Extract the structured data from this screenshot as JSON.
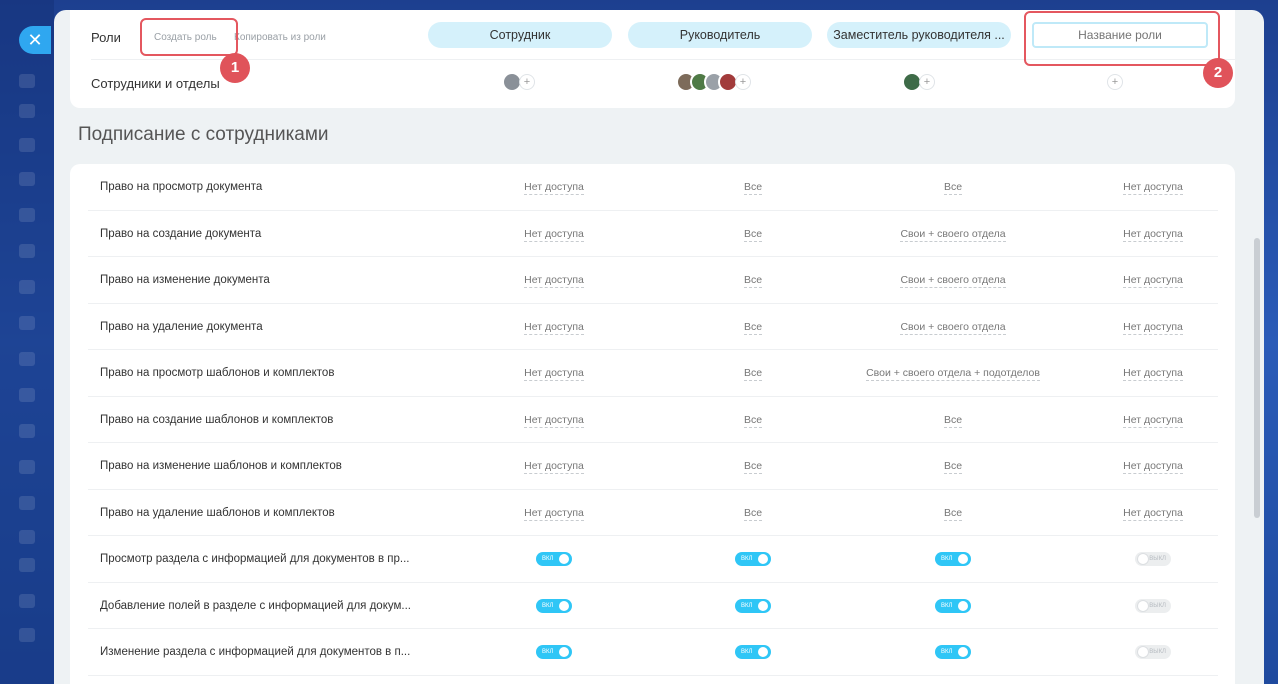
{
  "header": {
    "roles_label": "Роли",
    "create_role": "Создать роль",
    "copy_role": "Копировать из роли",
    "staff_label": "Сотрудники и отделы",
    "roles": [
      "Сотрудник",
      "Руководитель",
      "Заместитель руководителя ..."
    ],
    "new_role_placeholder": "Название роли"
  },
  "badges": [
    "1",
    "2"
  ],
  "section_title": "Подписание с сотрудниками",
  "toggle_on_label": "ВКЛ",
  "toggle_off_label": "ВЫКЛ",
  "rows": [
    {
      "label": "Право на просмотр документа",
      "values": [
        "Нет доступа",
        "Все",
        "Все",
        "Нет доступа"
      ]
    },
    {
      "label": "Право на создание документа",
      "values": [
        "Нет доступа",
        "Все",
        "Свои + своего отдела",
        "Нет доступа"
      ]
    },
    {
      "label": "Право на изменение документа",
      "values": [
        "Нет доступа",
        "Все",
        "Свои + своего отдела",
        "Нет доступа"
      ]
    },
    {
      "label": "Право на удаление документа",
      "values": [
        "Нет доступа",
        "Все",
        "Свои + своего отдела",
        "Нет доступа"
      ]
    },
    {
      "label": "Право на просмотр шаблонов и комплектов",
      "values": [
        "Нет доступа",
        "Все",
        "Свои + своего отдела + подотделов",
        "Нет доступа"
      ]
    },
    {
      "label": "Право на создание шаблонов и комплектов",
      "values": [
        "Нет доступа",
        "Все",
        "Все",
        "Нет доступа"
      ]
    },
    {
      "label": "Право на изменение шаблонов и комплектов",
      "values": [
        "Нет доступа",
        "Все",
        "Все",
        "Нет доступа"
      ]
    },
    {
      "label": "Право на удаление шаблонов и комплектов",
      "values": [
        "Нет доступа",
        "Все",
        "Все",
        "Нет доступа"
      ]
    },
    {
      "label": "Просмотр раздела с информацией для документов в пр...",
      "toggles": [
        true,
        true,
        true,
        false
      ]
    },
    {
      "label": "Добавление полей в разделе с информацией для докум...",
      "toggles": [
        true,
        true,
        true,
        false
      ]
    },
    {
      "label": "Изменение раздела с информацией для документов в п...",
      "toggles": [
        true,
        true,
        true,
        false
      ]
    }
  ],
  "colors": {
    "accent": "#2fc6f6",
    "role_pill": "#d5f1fb",
    "highlight": "#e4575f"
  }
}
